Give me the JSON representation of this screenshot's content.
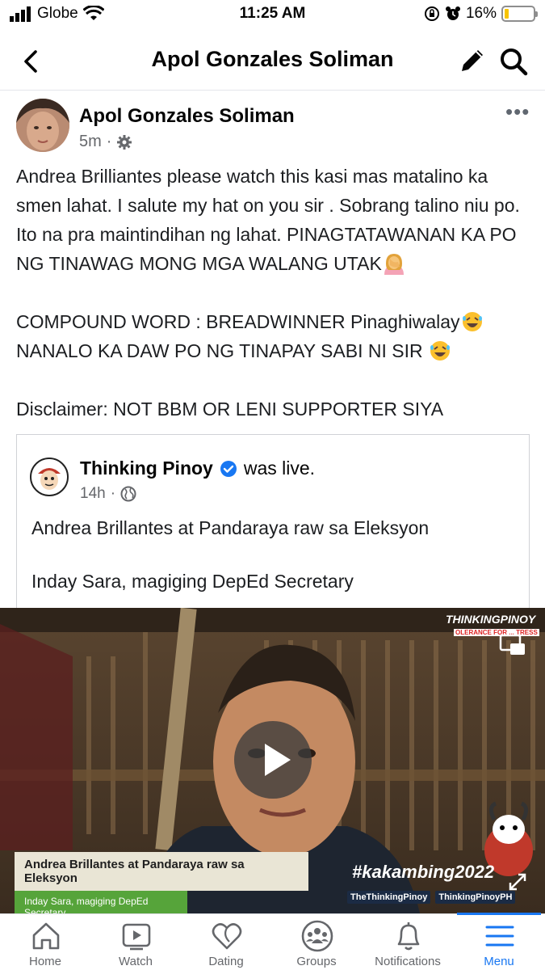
{
  "status_bar": {
    "carrier": "Globe",
    "time": "11:25 AM",
    "battery_percent": "16%",
    "battery_level": 0.16
  },
  "header": {
    "title": "Apol Gonzales Soliman",
    "icons": [
      "chevron-left-icon",
      "pencil-icon",
      "search-icon"
    ]
  },
  "post": {
    "author": "Apol Gonzales Soliman",
    "time": "5m",
    "separator": "·",
    "text": {
      "p1": "Andrea Brilliantes please watch this kasi mas matalino ka smen lahat. I salute my hat on you sir . Sobrang talino niu po. Ito na pra maintindihan ng lahat. PINAGTATAWANAN KA PO NG TINAWAG MONG MGA WALANG UTAK",
      "p2_line1": "COMPOUND WORD : BREADWINNER Pinaghiwalay",
      "p2_line2": "NANALO KA DAW PO NG TINAPAY SABI NI SIR ",
      "p3": "Disclaimer: NOT BBM OR LENI SUPPORTER SIYA"
    },
    "emojis": [
      "facepalm-emoji",
      "rofl-emoji",
      "rofl-emoji"
    ]
  },
  "shared": {
    "page_name": "Thinking Pinoy",
    "status": "was live.",
    "time": "14h",
    "separator": "·",
    "line1": "Andrea Brillantes at Pandaraya raw sa Eleksyon",
    "line2": "Inday Sara, magiging DepEd Secretary"
  },
  "video": {
    "lower_third_title": "Andrea Brillantes at Pandaraya raw sa Eleksyon",
    "lower_third_sub": "Inday Sara, magiging DepEd Secretary",
    "hashtag": "#kakambing2022",
    "social_fb": "TheThinkingPinoy",
    "social_yt": "ThinkingPinoyPH",
    "watermark": "THINKINGPINOY",
    "watermark_sub": "OLERANCE FOR ... TRESS"
  },
  "tabbar": {
    "items": [
      {
        "label": "Home",
        "icon": "home-icon"
      },
      {
        "label": "Watch",
        "icon": "video-icon"
      },
      {
        "label": "Dating",
        "icon": "heart-icon"
      },
      {
        "label": "Groups",
        "icon": "groups-icon"
      },
      {
        "label": "Notifications",
        "icon": "bell-icon"
      },
      {
        "label": "Menu",
        "icon": "hamburger-icon"
      }
    ],
    "active": "Menu"
  },
  "colors": {
    "accent": "#1877f2",
    "text": "#050505",
    "secondary_text": "#65676b",
    "battery": "#f7c400",
    "lower_third_green": "#56a43a"
  }
}
